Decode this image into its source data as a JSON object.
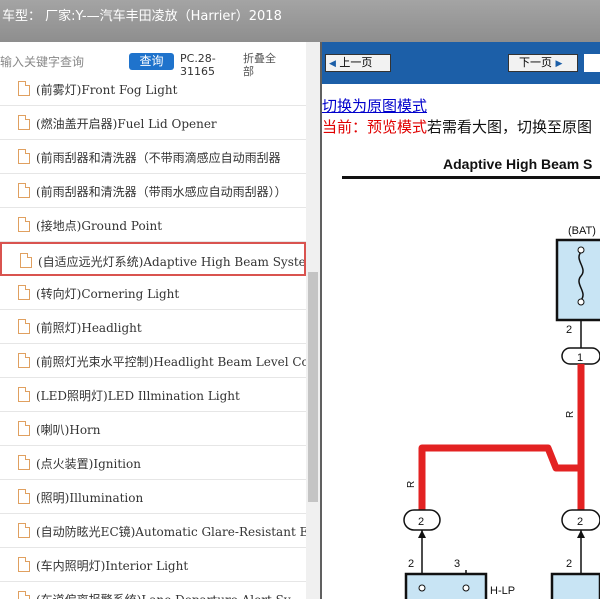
{
  "window": {
    "title": "车型：  厂家:Y-—汽车丰田凌放（Harrier）2018"
  },
  "search": {
    "placeholder": "输入关键字查询",
    "query_label": "查询",
    "pc_code": "PC.28-31165",
    "collapse_label": "折叠全部"
  },
  "tree": {
    "items": [
      {
        "label": "(前雾灯)Front Fog Light"
      },
      {
        "label": "(燃油盖开启器)Fuel Lid Opener"
      },
      {
        "label": "(前雨刮器和清洗器（不带雨滴感应自动雨刮器"
      },
      {
        "label": "(前雨刮器和清洗器（带雨水感应自动雨刮器））"
      },
      {
        "label": "(接地点)Ground Point"
      },
      {
        "label": "(自适应远光灯系统)Adaptive High Beam System"
      },
      {
        "label": "(转向灯)Cornering Light"
      },
      {
        "label": "(前照灯)Headlight"
      },
      {
        "label": "(前照灯光束水平控制)Headlight Beam Level Co"
      },
      {
        "label": "(LED照明灯)LED Illmination Light"
      },
      {
        "label": "(喇叭)Horn"
      },
      {
        "label": "(点火装置)Ignition"
      },
      {
        "label": "(照明)Illumination"
      },
      {
        "label": "(自动防眩光EC镜)Automatic Glare-Resistant EC"
      },
      {
        "label": "(车内照明灯)Interior Light"
      },
      {
        "label": "(车道偏离报警系统)Lane Departure Alert Sy"
      }
    ],
    "selected_index": 5
  },
  "viewer": {
    "prev_label": "上一页",
    "next_label": "下一页",
    "switch_link": "切换为原图模式",
    "preview_mode": "当前：预览模式",
    "preview_hint": "若需看大图，切换至原图"
  },
  "diagram": {
    "title": "Adaptive High Beam S",
    "bat_label": "(BAT)",
    "wire_r_1": "R",
    "wire_r_2": "R",
    "pin_2a": "2",
    "pin_2b": "2",
    "pin_2c": "2",
    "pin_2d": "2",
    "pin_3": "3",
    "connector_1": "1",
    "connector_2a": "2",
    "connector_2b": "2",
    "hlp_label": "H-LP"
  },
  "colors": {
    "title_bar": "#999999",
    "query_button": "#1f73cc",
    "nav_bar": "#1c5fa8",
    "selection_border": "#d9534f",
    "wire_red": "#e32222",
    "fuse_box": "#c8e4f4"
  }
}
